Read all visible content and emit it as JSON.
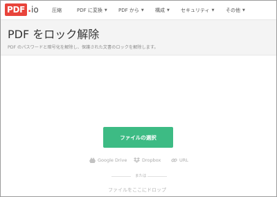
{
  "brand": {
    "logo_main": "PDF",
    "logo_suffix": "io",
    "accent": "#e8443b"
  },
  "nav": {
    "items": [
      {
        "label": "圧縮",
        "dropdown": false
      },
      {
        "label": "PDF に変換",
        "dropdown": true
      },
      {
        "label": "PDF から",
        "dropdown": true
      },
      {
        "label": "構成",
        "dropdown": true
      },
      {
        "label": "セキュリティ",
        "dropdown": true
      },
      {
        "label": "その他",
        "dropdown": true
      }
    ]
  },
  "header": {
    "title": "PDF をロック解除",
    "subtitle": "PDF のパスワードと暗号化を解除し、保護された文書のロックを解除します。"
  },
  "upload": {
    "button_label": "ファイルの選択",
    "button_color": "#3dbb84",
    "sources": [
      {
        "label": "Google Drive",
        "icon": "google-drive-icon"
      },
      {
        "label": "Dropbox",
        "icon": "dropbox-icon"
      },
      {
        "label": "URL",
        "icon": "link-icon"
      }
    ],
    "or_label": "または",
    "drop_label": "ファイルをここにドロップ"
  }
}
